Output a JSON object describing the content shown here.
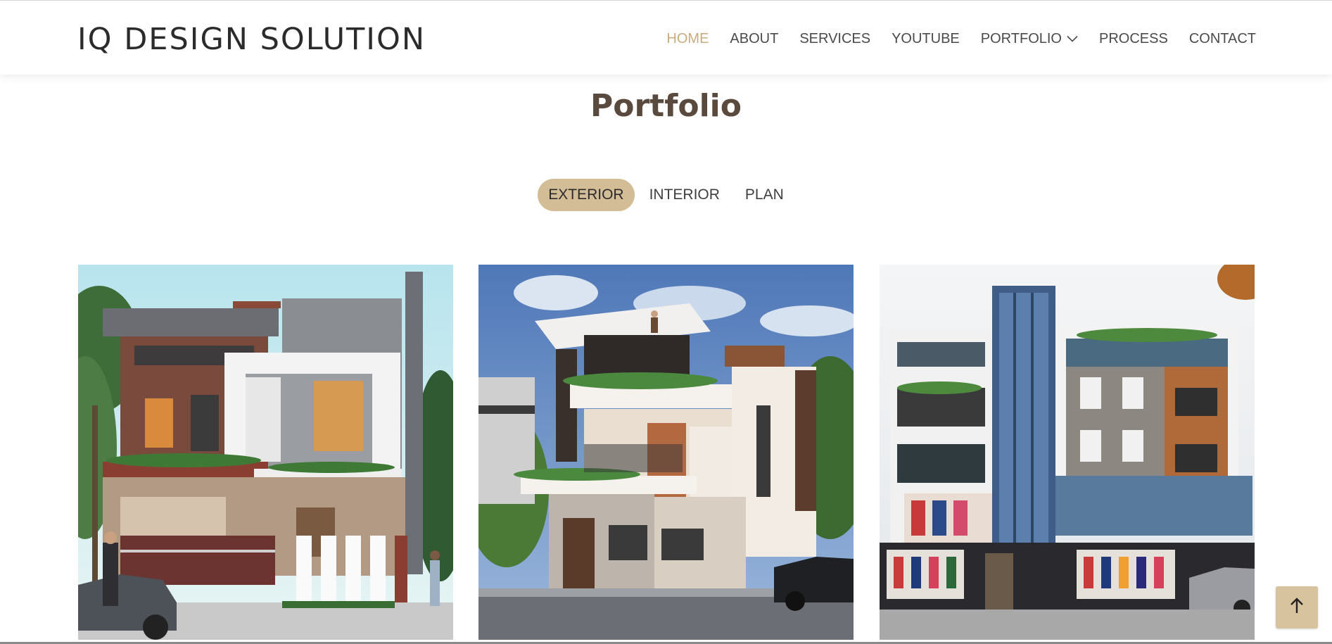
{
  "brand": {
    "name": "IQ DESIGN SOLUTION"
  },
  "nav": {
    "items": [
      {
        "label": "HOME",
        "active": true
      },
      {
        "label": "ABOUT"
      },
      {
        "label": "SERVICES"
      },
      {
        "label": "YOUTUBE"
      },
      {
        "label": "PORTFOLIO",
        "dropdown": true
      },
      {
        "label": "PROCESS"
      },
      {
        "label": "CONTACT"
      }
    ]
  },
  "section": {
    "title": "Portfolio"
  },
  "filters": [
    {
      "label": "EXTERIOR",
      "active": true
    },
    {
      "label": "INTERIOR"
    },
    {
      "label": "PLAN"
    }
  ],
  "portfolio": {
    "items": [
      {
        "icon": "house-render-image"
      },
      {
        "icon": "villa-render-image"
      },
      {
        "icon": "commercial-building-render-image"
      }
    ]
  },
  "colors": {
    "accent": "#c9ab80",
    "filter_active_bg": "#d3bd96",
    "title": "#5a4a3e",
    "back_to_top_bg": "#d7c39e"
  },
  "icons": {
    "back_to_top": "arrow-up-icon",
    "dropdown": "chevron-down-icon"
  }
}
